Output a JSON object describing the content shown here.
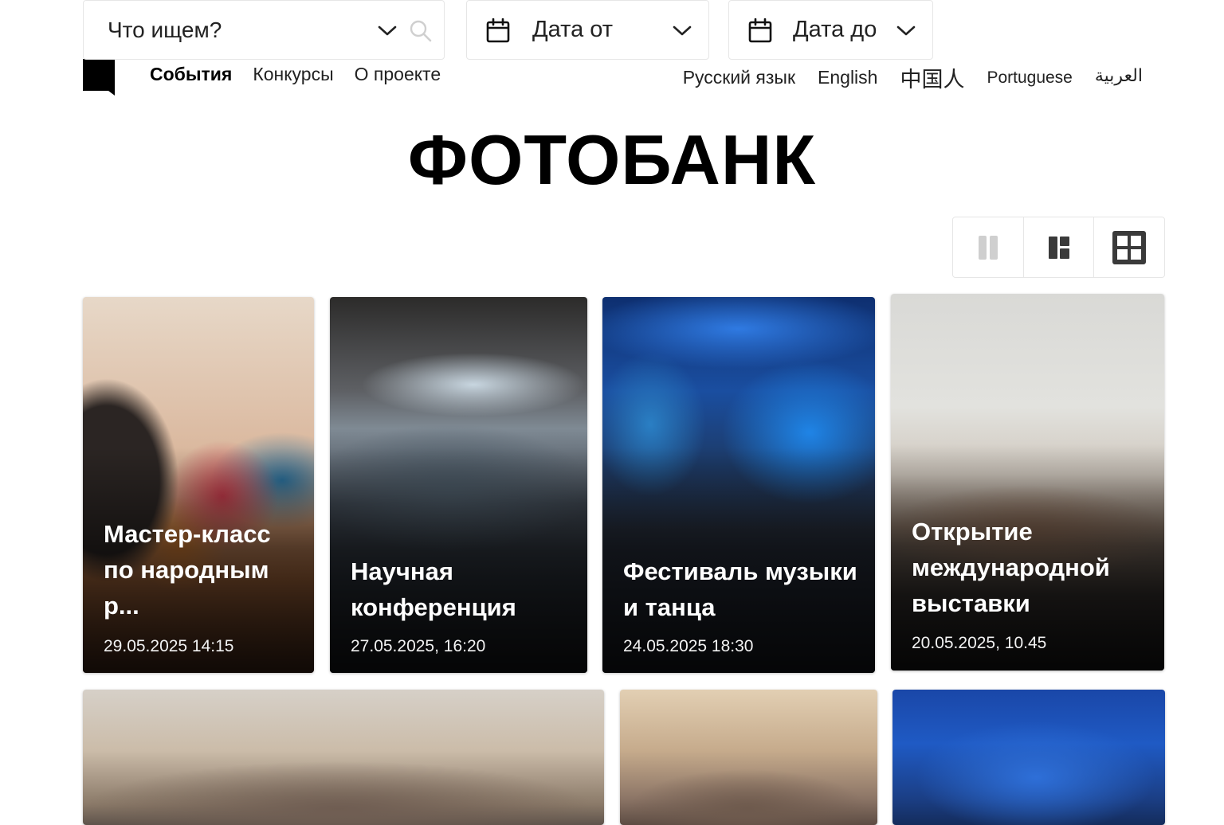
{
  "header": {
    "nav": [
      {
        "label": "События",
        "active": true
      },
      {
        "label": "Конкурсы",
        "active": false
      },
      {
        "label": "О проекте",
        "active": false
      }
    ],
    "languages": [
      "Русский язык",
      "English",
      "中国人",
      "Portuguese",
      "العربية"
    ]
  },
  "page_title": "ФОТОБАНК",
  "filters": {
    "search_placeholder": "Что ищем?",
    "date_from": "Дата от",
    "date_to": "Дата до"
  },
  "view_modes": {
    "options": [
      "columns-icon",
      "masonry-icon",
      "grid-icon"
    ],
    "selected": "grid-icon"
  },
  "events": [
    {
      "title": "Мастер-класс по народным р...",
      "date": "29.05.2025  14:15"
    },
    {
      "title": "Научная конференция",
      "date": "27.05.2025, 16:20"
    },
    {
      "title": "Фестиваль музыки и танца",
      "date": "24.05.2025  18:30"
    },
    {
      "title": "Открытие международной выставки",
      "date": "20.05.2025, 10.45"
    }
  ],
  "colors": {
    "text": "#111111",
    "border": "#e6e6e6",
    "icon_active": "#3a3a3a",
    "icon_inactive": "#cfcfcf"
  }
}
